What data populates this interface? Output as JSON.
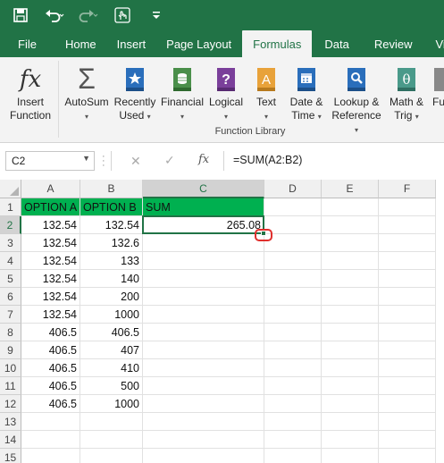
{
  "qat": {
    "icons": [
      "save-icon",
      "undo-icon",
      "redo-icon",
      "touch-mode-icon",
      "customize-qat-icon"
    ],
    "dropdown_glyph": "▾"
  },
  "tabs": [
    {
      "label": "File",
      "active": false
    },
    {
      "label": "Home",
      "active": false
    },
    {
      "label": "Insert",
      "active": false
    },
    {
      "label": "Page Layout",
      "active": false
    },
    {
      "label": "Formulas",
      "active": true
    },
    {
      "label": "Data",
      "active": false
    },
    {
      "label": "Review",
      "active": false
    },
    {
      "label": "View",
      "active": false
    }
  ],
  "ribbon": {
    "insert_function": {
      "line1": "Insert",
      "line2": "Function",
      "icon": "fx-icon"
    },
    "buttons": [
      {
        "line1": "AutoSum",
        "line2": "",
        "icon": "sigma-icon"
      },
      {
        "line1": "Recently",
        "line2": "Used",
        "icon": "star-book-icon"
      },
      {
        "line1": "Financial",
        "line2": "",
        "icon": "financial-book-icon"
      },
      {
        "line1": "Logical",
        "line2": "",
        "icon": "question-book-icon"
      },
      {
        "line1": "Text",
        "line2": "",
        "icon": "text-book-icon"
      },
      {
        "line1": "Date &",
        "line2": "Time",
        "icon": "calendar-book-icon"
      },
      {
        "line1": "Lookup &",
        "line2": "Reference",
        "icon": "lookup-book-icon"
      },
      {
        "line1": "Math &",
        "line2": "Trig",
        "icon": "theta-book-icon"
      },
      {
        "line1": "Fu",
        "line2": "",
        "icon": "more-functions-icon"
      }
    ],
    "group_label": "Function Library",
    "colors": {
      "sigma": "#555555",
      "star": "#2a6ebb",
      "financial": "#4a8f4a",
      "logical": "#7a3f9a",
      "text": "#e8a23a",
      "date": "#2a6ebb",
      "lookup": "#2a6ebb",
      "math": "#4a9a8a"
    }
  },
  "formula_bar": {
    "name_box": "C2",
    "fx_label": "fx",
    "formula": "=SUM(A2:B2)"
  },
  "grid": {
    "columns": [
      "A",
      "B",
      "C",
      "D",
      "E",
      "F"
    ],
    "selected_column": "C",
    "selected_row": "2",
    "rows": [
      {
        "num": "1",
        "cells": [
          "OPTION A",
          "OPTION B",
          "SUM",
          "",
          "",
          ""
        ]
      },
      {
        "num": "2",
        "cells": [
          "132.54",
          "132.54",
          "265.08",
          "",
          "",
          ""
        ]
      },
      {
        "num": "3",
        "cells": [
          "132.54",
          "132.6",
          "",
          "",
          "",
          ""
        ]
      },
      {
        "num": "4",
        "cells": [
          "132.54",
          "133",
          "",
          "",
          "",
          ""
        ]
      },
      {
        "num": "5",
        "cells": [
          "132.54",
          "140",
          "",
          "",
          "",
          ""
        ]
      },
      {
        "num": "6",
        "cells": [
          "132.54",
          "200",
          "",
          "",
          "",
          ""
        ]
      },
      {
        "num": "7",
        "cells": [
          "132.54",
          "1000",
          "",
          "",
          "",
          ""
        ]
      },
      {
        "num": "8",
        "cells": [
          "406.5",
          "406.5",
          "",
          "",
          "",
          ""
        ]
      },
      {
        "num": "9",
        "cells": [
          "406.5",
          "407",
          "",
          "",
          "",
          ""
        ]
      },
      {
        "num": "10",
        "cells": [
          "406.5",
          "410",
          "",
          "",
          "",
          ""
        ]
      },
      {
        "num": "11",
        "cells": [
          "406.5",
          "500",
          "",
          "",
          "",
          ""
        ]
      },
      {
        "num": "12",
        "cells": [
          "406.5",
          "1000",
          "",
          "",
          "",
          ""
        ]
      },
      {
        "num": "13",
        "cells": [
          "",
          "",
          "",
          "",
          "",
          ""
        ]
      },
      {
        "num": "14",
        "cells": [
          "",
          "",
          "",
          "",
          "",
          ""
        ]
      },
      {
        "num": "15",
        "cells": [
          "",
          "",
          "",
          "",
          "",
          ""
        ]
      }
    ],
    "header_fill": "#00b050",
    "accent": "#217346",
    "annotation_color": "#e0302d"
  }
}
